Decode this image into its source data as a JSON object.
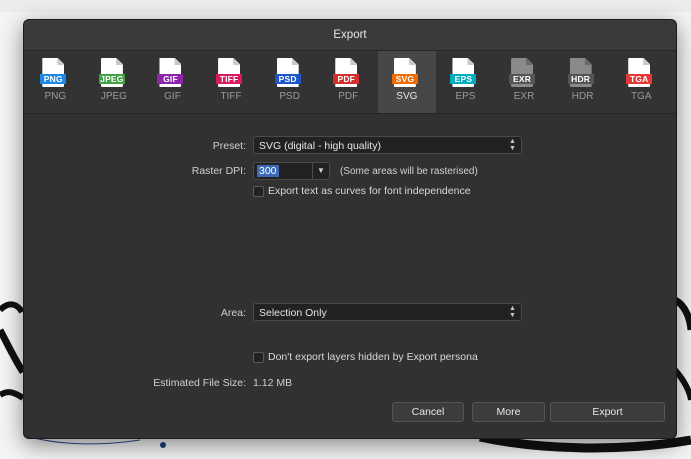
{
  "dialog": {
    "title": "Export"
  },
  "formats": [
    {
      "name": "PNG",
      "color": "#1e88e5"
    },
    {
      "name": "JPEG",
      "color": "#43a047"
    },
    {
      "name": "GIF",
      "color": "#8e24aa"
    },
    {
      "name": "TIFF",
      "color": "#d81b60"
    },
    {
      "name": "PSD",
      "color": "#1e56c8"
    },
    {
      "name": "PDF",
      "color": "#d32f2f"
    },
    {
      "name": "SVG",
      "color": "#ef6c00"
    },
    {
      "name": "EPS",
      "color": "#00acc1"
    },
    {
      "name": "EXR",
      "color": "#555555"
    },
    {
      "name": "HDR",
      "color": "#555555"
    },
    {
      "name": "TGA",
      "color": "#e53935"
    }
  ],
  "selected_format": "SVG",
  "preset": {
    "label": "Preset:",
    "value": "SVG (digital - high quality)"
  },
  "raster_dpi": {
    "label": "Raster DPI:",
    "value": "300",
    "note": "(Some areas will be rasterised)"
  },
  "text_curves": {
    "label": "Export text as curves for font independence",
    "checked": false
  },
  "area": {
    "label": "Area:",
    "value": "Selection Only"
  },
  "hidden_layers": {
    "label": "Don't export layers hidden by Export persona",
    "checked": false
  },
  "file_size": {
    "label": "Estimated File Size:",
    "value": "1.12 MB"
  },
  "buttons": {
    "cancel": "Cancel",
    "more": "More",
    "export": "Export"
  },
  "theme": {
    "dialog_bg": "#313131",
    "accent": "#3d69b8"
  }
}
